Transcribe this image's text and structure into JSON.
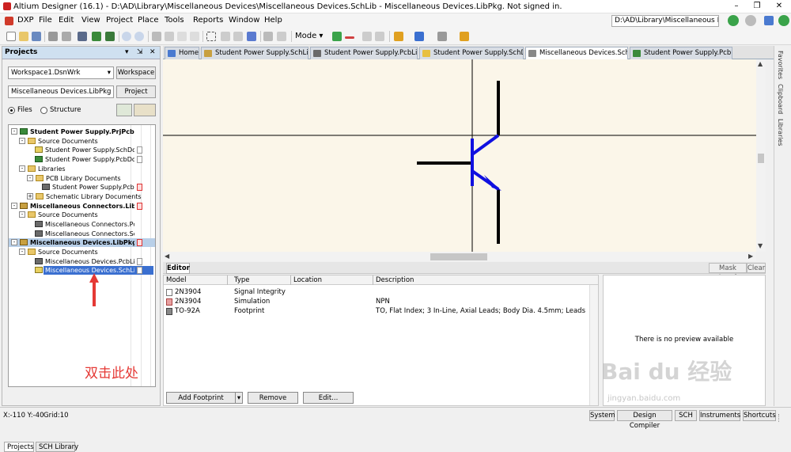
{
  "window": {
    "title": "Altium Designer (16.1) - D:\\AD\\Library\\Miscellaneous Devices\\Miscellaneous Devices.SchLib - Miscellaneous Devices.LibPkg. Not signed in.",
    "controls": [
      "–",
      "❐",
      "✕"
    ]
  },
  "menubar": {
    "items": [
      "DXP",
      "File",
      "Edit",
      "View",
      "Project",
      "Place",
      "Tools",
      "Reports",
      "Window",
      "Help"
    ],
    "path": "D:\\AD\\Library\\Miscellaneous D"
  },
  "toolbar": {
    "mode_label": "Mode"
  },
  "projects_panel": {
    "title": "Projects",
    "controls": [
      "▾",
      "⇲",
      "✕"
    ],
    "workspace": "Workspace1.DsnWrk",
    "workspace_button": "Workspace",
    "project": "Miscellaneous Devices.LibPkg",
    "project_button": "Project",
    "radio_files": "Files",
    "radio_structure": "Structure",
    "tree": [
      "Student Power Supply.PrjPcb",
      "Source Documents",
      "Student Power Supply.SchDoc",
      "Student Power Supply.PcbDoc",
      "Libraries",
      "PCB Library Documents",
      "Student Power Supply.PcbLi",
      "Schematic Library Documents",
      "Miscellaneous Connectors.LibPkg",
      "Source Documents",
      "Miscellaneous Connectors.Pcb",
      "Miscellaneous Connectors.Sch",
      "Miscellaneous Devices.LibPkg *",
      "Source Documents",
      "Miscellaneous Devices.PcbLib",
      "Miscellaneous Devices.SchLib"
    ],
    "annotation": "双击此处",
    "tabs": [
      "Projects",
      "SCH Library"
    ]
  },
  "document_tabs": [
    "Home",
    "Student Power Supply.SchLib *",
    "Student Power Supply.PcbLib *",
    "Student Power Supply.SchDoc",
    "Miscellaneous Devices.SchLib",
    "Student Power Supply.PcbDoc"
  ],
  "right_bar": [
    "Favorites",
    "Clipboard",
    "Libraries"
  ],
  "editor": {
    "tab": "Editor",
    "mask_level": "Mask Level",
    "clear": "Clear",
    "columns": [
      "Model",
      "Type",
      "Location",
      "Description"
    ],
    "rows": [
      {
        "model": "2N3904",
        "type": "Signal Integrity",
        "location": "",
        "description": ""
      },
      {
        "model": "2N3904",
        "type": "Simulation",
        "location": "",
        "description": "NPN"
      },
      {
        "model": "TO-92A",
        "type": "Footprint",
        "location": "",
        "description": "TO, Flat Index; 3 In-Line, Axial Leads; Body Dia. 4.5mm; Leads 0.51 x 0.48 m..."
      }
    ],
    "preview_message": "There is no preview available",
    "buttons": {
      "add_footprint": "Add Footprint",
      "remove": "Remove",
      "edit": "Edit..."
    }
  },
  "watermark": {
    "main": "Bai du 经验",
    "sub": "jingyan.baidu.com"
  },
  "status_bar": {
    "coords": "X:-110 Y:-40",
    "grid": "Grid:10",
    "buttons": [
      "System",
      "Design Compiler",
      "SCH",
      "Instruments",
      "Shortcuts"
    ]
  },
  "colors": {
    "accent": "#3a6fd0",
    "symbol_blue": "#1010e0",
    "annotation_red": "#e53935",
    "canvas": "#fbf6e9"
  }
}
